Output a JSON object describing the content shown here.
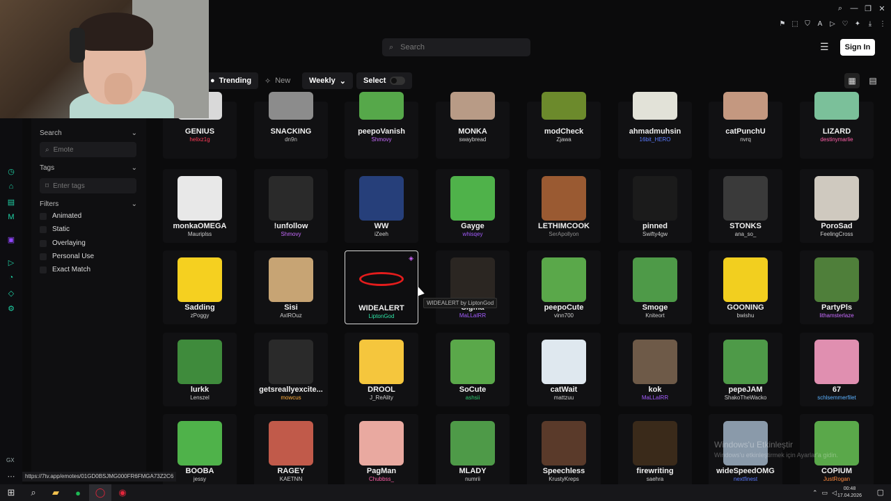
{
  "browser": {
    "window_controls": [
      "search",
      "minimize",
      "maximize",
      "close"
    ],
    "status_url": "https://7tv.app/emotes/01GD0BSJMG000FR6FMGA73Z2C6",
    "sidebar_label": "GX"
  },
  "header": {
    "search_placeholder": "Search",
    "signin_label": "Sign In"
  },
  "filters_bar": {
    "trending": "Trending",
    "new": "New",
    "weekly": "Weekly",
    "select": "Select"
  },
  "panel": {
    "search_title": "Search",
    "emote_placeholder": "Emote",
    "tags_title": "Tags",
    "tags_placeholder": "Enter tags",
    "filters_title": "Filters",
    "options": [
      "Animated",
      "Static",
      "Overlaying",
      "Personal Use",
      "Exact Match"
    ]
  },
  "emotes": [
    [
      {
        "name": "GENIUS",
        "author": "helixz1g",
        "color": "#ff3b57",
        "art": "#d9d9d9"
      },
      {
        "name": "SNACKING",
        "author": "dn9n",
        "color": "#bdbdbd",
        "art": "#8c8c8c"
      },
      {
        "name": "peepoVanish",
        "author": "Shmovy",
        "color": "#c86bff",
        "art": "#56a84a"
      },
      {
        "name": "MONKA",
        "author": "swaybread",
        "color": "#cfcfcf",
        "art": "#b89b86"
      },
      {
        "name": "modCheck",
        "author": "Zjawa",
        "color": "#cfcfcf",
        "art": "#6c8a2c"
      },
      {
        "name": "ahmadmuhsin",
        "author": "16bit_HERO",
        "color": "#5b7bff",
        "art": "#e2e2d8"
      },
      {
        "name": "catPunchU",
        "author": "nvrq",
        "color": "#cfcfcf",
        "art": "#c49880"
      },
      {
        "name": "LIZARD",
        "author": "destinymarlie",
        "color": "#ff5fa8",
        "art": "#7bc09a"
      }
    ],
    [
      {
        "name": "monkaOMEGA",
        "author": "Mauriplss",
        "color": "#cfcfcf",
        "art": "#e8e8e8"
      },
      {
        "name": "!unfollow",
        "author": "Shmovy",
        "color": "#c86bff",
        "art": "#2a2a2a"
      },
      {
        "name": "WW",
        "author": "iZeeh",
        "color": "#cfcfcf",
        "art": "#263f7a"
      },
      {
        "name": "Gayge",
        "author": "whisqey",
        "color": "#a45cff",
        "art": "#4fb24a"
      },
      {
        "name": "LETHIMCOOK",
        "author": "SerApollyon",
        "color": "#8f8f8f",
        "art": "#9a5a32"
      },
      {
        "name": "pinned",
        "author": "Swifty4gw",
        "color": "#cfcfcf",
        "art": "#1b1b1b"
      },
      {
        "name": "STONKS",
        "author": "ana_so_",
        "color": "#cfcfcf",
        "art": "#3a3a3a"
      },
      {
        "name": "PoroSad",
        "author": "FeelingCross",
        "color": "#cfcfcf",
        "art": "#cfc9bf"
      }
    ],
    [
      {
        "name": "Sadding",
        "author": "zPoggy",
        "color": "#cfcfcf",
        "art": "#f5d020"
      },
      {
        "name": "Sisi",
        "author": "AxlROuz",
        "color": "#cfcfcf",
        "art": "#c7a474"
      },
      {
        "name": "WIDEALERT",
        "author": "LiptonGod",
        "color": "#2ee6a8",
        "art": "#e31c1c"
      },
      {
        "name": "Sigma",
        "author": "MaLLaIRR",
        "color": "#a45cff",
        "art": "#2b2622"
      },
      {
        "name": "peepoCute",
        "author": "vinn700",
        "color": "#cfcfcf",
        "art": "#5aa84a"
      },
      {
        "name": "Smoge",
        "author": "Kniteort",
        "color": "#cfcfcf",
        "art": "#4e9a48"
      },
      {
        "name": "GOONING",
        "author": "bwishu",
        "color": "#cfcfcf",
        "art": "#f2cf1f"
      },
      {
        "name": "PartyPls",
        "author": "lithamsterlaze",
        "color": "#c86bff",
        "art": "#4f7f3a"
      }
    ],
    [
      {
        "name": "lurkk",
        "author": "Lenszel",
        "color": "#cfcfcf",
        "art": "#3f8b3c"
      },
      {
        "name": "getsreallyexcite...",
        "author": "mowcus",
        "color": "#ffae3d",
        "art": "#2a2a2a"
      },
      {
        "name": "DROOL",
        "author": "J_ReAlity",
        "color": "#cfcfcf",
        "art": "#f5c63d"
      },
      {
        "name": "SoCute",
        "author": "ashsii",
        "color": "#2ecc71",
        "art": "#5aa84a"
      },
      {
        "name": "catWait",
        "author": "mattzuu",
        "color": "#cfcfcf",
        "art": "#dfe8ef"
      },
      {
        "name": "kok",
        "author": "MaLLaIRR",
        "color": "#a45cff",
        "art": "#6e5a48"
      },
      {
        "name": "pepeJAM",
        "author": "ShakoTheWacko",
        "color": "#cfcfcf",
        "art": "#4e9a48"
      },
      {
        "name": "67",
        "author": "schlsemmerfilet",
        "color": "#5bb1ff",
        "art": "#e08fb0"
      }
    ],
    [
      {
        "name": "BOOBA",
        "author": "jessy",
        "color": "#cfcfcf",
        "art": "#4fb24a"
      },
      {
        "name": "RAGEY",
        "author": "KAETNN",
        "color": "#cfcfcf",
        "art": "#c15a4a"
      },
      {
        "name": "PagMan",
        "author": "Chubbss_",
        "color": "#ff5fa8",
        "art": "#e9a9a0"
      },
      {
        "name": "MLADY",
        "author": "numrii",
        "color": "#cfcfcf",
        "art": "#4e9a48"
      },
      {
        "name": "Speechless",
        "author": "KrustyKreps",
        "color": "#cfcfcf",
        "art": "#5a3a2a"
      },
      {
        "name": "firewriting",
        "author": "saehra",
        "color": "#cfcfcf",
        "art": "#3a2a1a"
      },
      {
        "name": "wideSpeedOMG",
        "author": "nextfinest",
        "color": "#5b7bff",
        "art": "#8a9aaa"
      },
      {
        "name": "COPIUM",
        "author": "JustRogan",
        "color": "#ff8a3d",
        "art": "#5aa84a"
      }
    ]
  ],
  "tooltip": "WIDEALERT by LiptonGod",
  "watermark": {
    "title": "Windows'u Etkinleştir",
    "subtitle": "Windows'u etkinleştirmek için Ayarlar'a gidin."
  },
  "taskbar": {
    "time": "00:48",
    "date": "17.04.2026"
  }
}
